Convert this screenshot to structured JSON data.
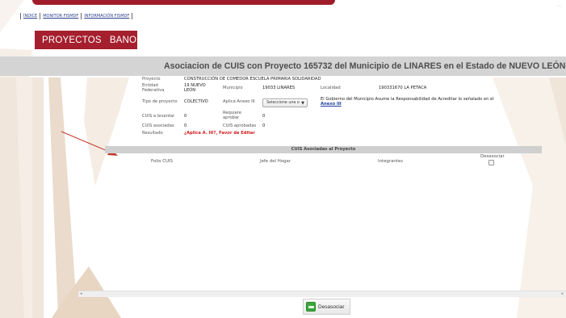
{
  "top_links": [
    "ÍNDICE",
    "MONITOR FISMDF",
    "INFORMACIÓN FISMDF"
  ],
  "brand": {
    "left": "PROYECTOS",
    "right": "BANOBRAS"
  },
  "corner_mark": "...",
  "page_title": "Asociacion de CUIS con Proyecto 165732 del Municipio de LINARES en el Estado de NUEVO LEÓN",
  "info": {
    "proyecto_label": "Proyecto",
    "proyecto_value": "CONSTRUCCIÓN DE COMEDOR ESCUELA PRIMARIA SOLIDARIDAD",
    "entidad_label_1": "Entidad",
    "entidad_label_2": "Federativa",
    "entidad_value_1": "19 NUEVO",
    "entidad_value_2": "LEÓN",
    "municipio_label": "Municipio",
    "municipio_value": "19033 LINARES",
    "localidad_label": "Localidad",
    "localidad_value": "190331670 LA PETACA",
    "tipo_label": "Tipo de proyecto",
    "tipo_value": "COLECTIVO",
    "aplica_label": "Aplica Anexo III",
    "aplica_select": "Seleccione una o",
    "gobierno_text": "El Gobierno del Municipio Asume la Responsabilidad de Acreditar lo señalado en el",
    "anexo_link": "Anexo III",
    "cuis_levantar_label": "CUIS a levantar",
    "cuis_levantar_value": "0",
    "requiere_label_1": "Requiere",
    "requiere_label_2": "aprobar",
    "requiere_value": "0",
    "cuis_asociadas_label": "CUIS asociadas",
    "cuis_asociadas_value": "0",
    "cuis_aprobadas_label": "CUIS aprobadas",
    "cuis_aprobadas_value": "0",
    "resultado_label": "Resultado",
    "resultado_value": "¿Aplica A. III?, Favor de Editar"
  },
  "section_title": "CUIS Asociadas al Proyecto",
  "columns": {
    "folio": "Folio CUIS",
    "jefe": "Jefe del Hogar",
    "integrantes": "Integrantes",
    "desasociar": "Desasociar"
  },
  "button": {
    "label": "Desasociar"
  },
  "colors": {
    "brand": "#a51f2e",
    "accent_link": "#1e3ea0",
    "alert": "#d11b1b"
  }
}
